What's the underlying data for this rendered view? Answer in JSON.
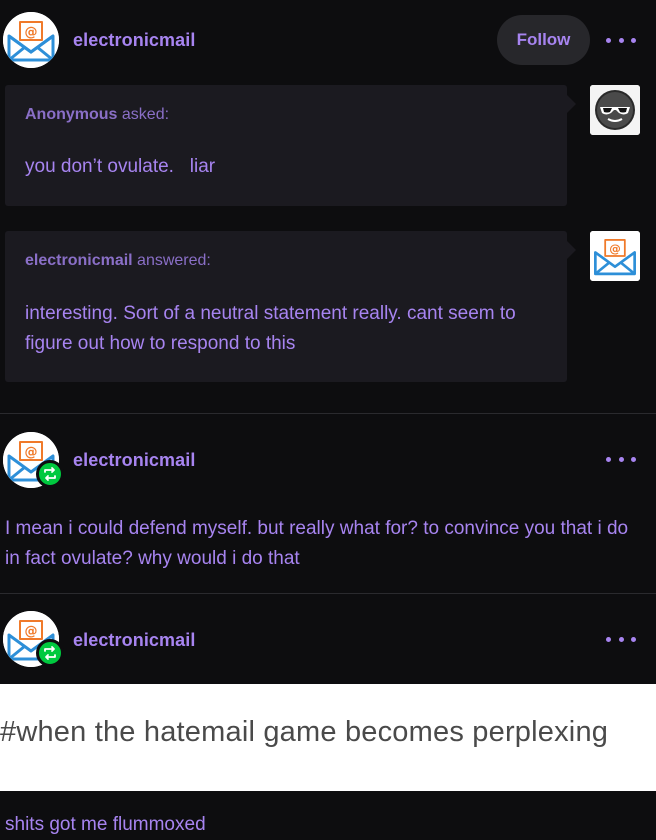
{
  "post": {
    "username": "electronicmail",
    "follow_label": "Follow",
    "more_icon": "more-options-icon"
  },
  "ask": {
    "asker_name": "Anonymous",
    "asked_suffix": " asked:",
    "question": "you don’t ovulate.   liar",
    "asker_avatar": "sunglasses-face-icon"
  },
  "answer": {
    "answerer_name": "electronicmail",
    "answered_suffix": " answered:",
    "text": "interesting. Sort of a neutral statement really. cant seem to figure out how to respond to this"
  },
  "reblog1": {
    "username": "electronicmail",
    "text": "I mean i could defend myself. but really what for? to convince you that i do in fact ovulate? why would i do that"
  },
  "reblog2": {
    "username": "electronicmail",
    "tag_heading": "#when the hatemail game becomes perplexing",
    "text": "shits got me flummoxed"
  },
  "colors": {
    "background": "#0d0d0f",
    "accent": "#a784f0",
    "bubble": "#1b1a20",
    "reblog_badge": "#00c93f"
  }
}
